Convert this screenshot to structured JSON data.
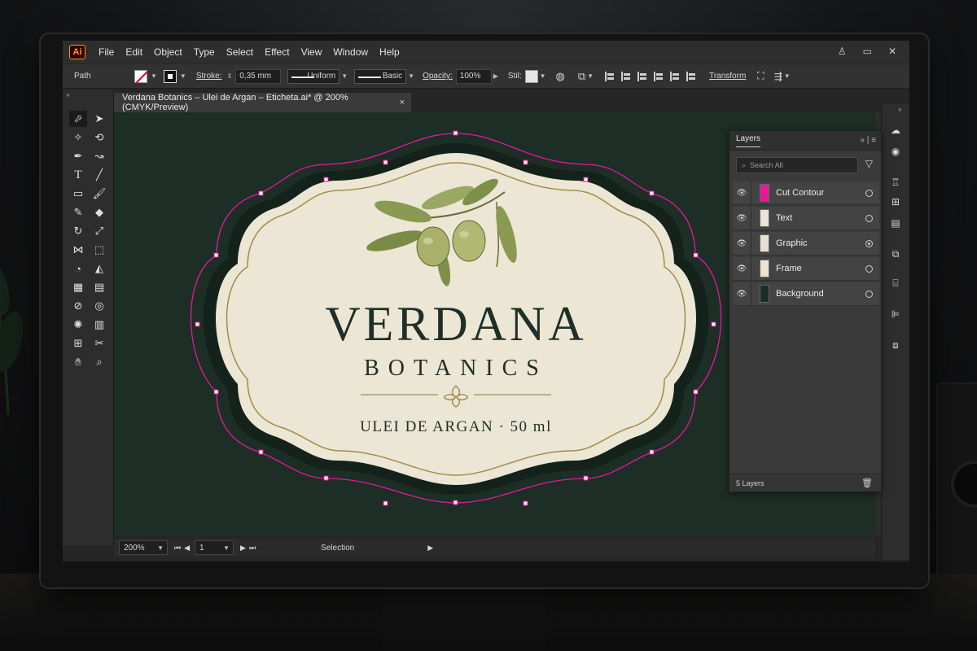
{
  "app": {
    "logo": "Ai"
  },
  "menu": [
    "File",
    "Edit",
    "Object",
    "Type",
    "Select",
    "Effect",
    "View",
    "Window",
    "Help"
  ],
  "control_bar": {
    "selection_type": "Path",
    "stroke_label": "Stroke:",
    "stroke_weight": "0,35 mm",
    "profile": "Uniform",
    "brush": "Basic",
    "opacity_label": "Opacity:",
    "opacity_value": "100%",
    "style_label": "Stil:",
    "transform_label": "Transform"
  },
  "document_tab": {
    "title": "Verdana Botanics – Ulei de Argan – Eticheta.ai* @ 200% (CMYK/Preview)",
    "close": "×"
  },
  "label": {
    "brand": "VERDANA",
    "sub_brand": "BOTANICS",
    "product": "ULEI DE ARGAN · 50 ml",
    "colors": {
      "cream": "#ece6d4",
      "dark_green": "#1c2e25",
      "cut_contour": "#e6189a",
      "gold": "#a08c4a",
      "olive": "#8a9a52"
    }
  },
  "layers_panel": {
    "title": "Layers",
    "search_placeholder": "Search All",
    "layers": [
      {
        "name": "Cut Contour",
        "color": "#e6189a",
        "target_on": false
      },
      {
        "name": "Text",
        "color": "#e8e4da",
        "target_on": false
      },
      {
        "name": "Graphic",
        "color": "#e3dfd2",
        "target_on": true
      },
      {
        "name": "Frame",
        "color": "#ebe4d2",
        "target_on": false
      },
      {
        "name": "Background",
        "color": "#1c2e25",
        "target_on": false
      }
    ],
    "footer": "5 Layers"
  },
  "status_bar": {
    "zoom": "200%",
    "artboard": "1",
    "tool": "Selection"
  }
}
